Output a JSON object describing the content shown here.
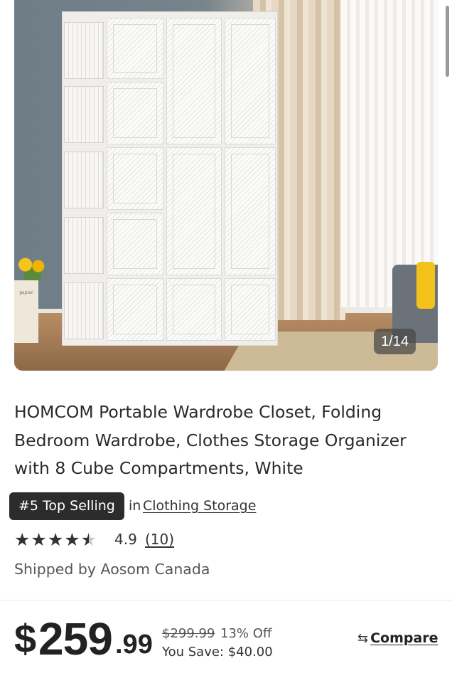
{
  "gallery": {
    "counter": "1/14",
    "book_label": "papier"
  },
  "product": {
    "title_lines": [
      "HOMCOM Portable Wardrobe Closet, Folding",
      "Bedroom Wardrobe, Clothes Storage Organizer",
      "with 8 Cube Compartments, White"
    ],
    "badge": "#5 Top Selling",
    "badge_in": "in",
    "badge_category": "Clothing Storage",
    "rating_value": "4.9",
    "rating_stars": 4.5,
    "reviews": "(10)",
    "shipped_by": "Shipped by Aosom Canada"
  },
  "price": {
    "currency": "$",
    "whole": "259",
    "cents": ".99",
    "was": "$299.99",
    "percent_off": "13% Off",
    "you_save": "You Save: $40.00",
    "compare_label": "Compare"
  },
  "colors": {
    "badge_bg": "#2c2c2c",
    "text": "#222222"
  }
}
